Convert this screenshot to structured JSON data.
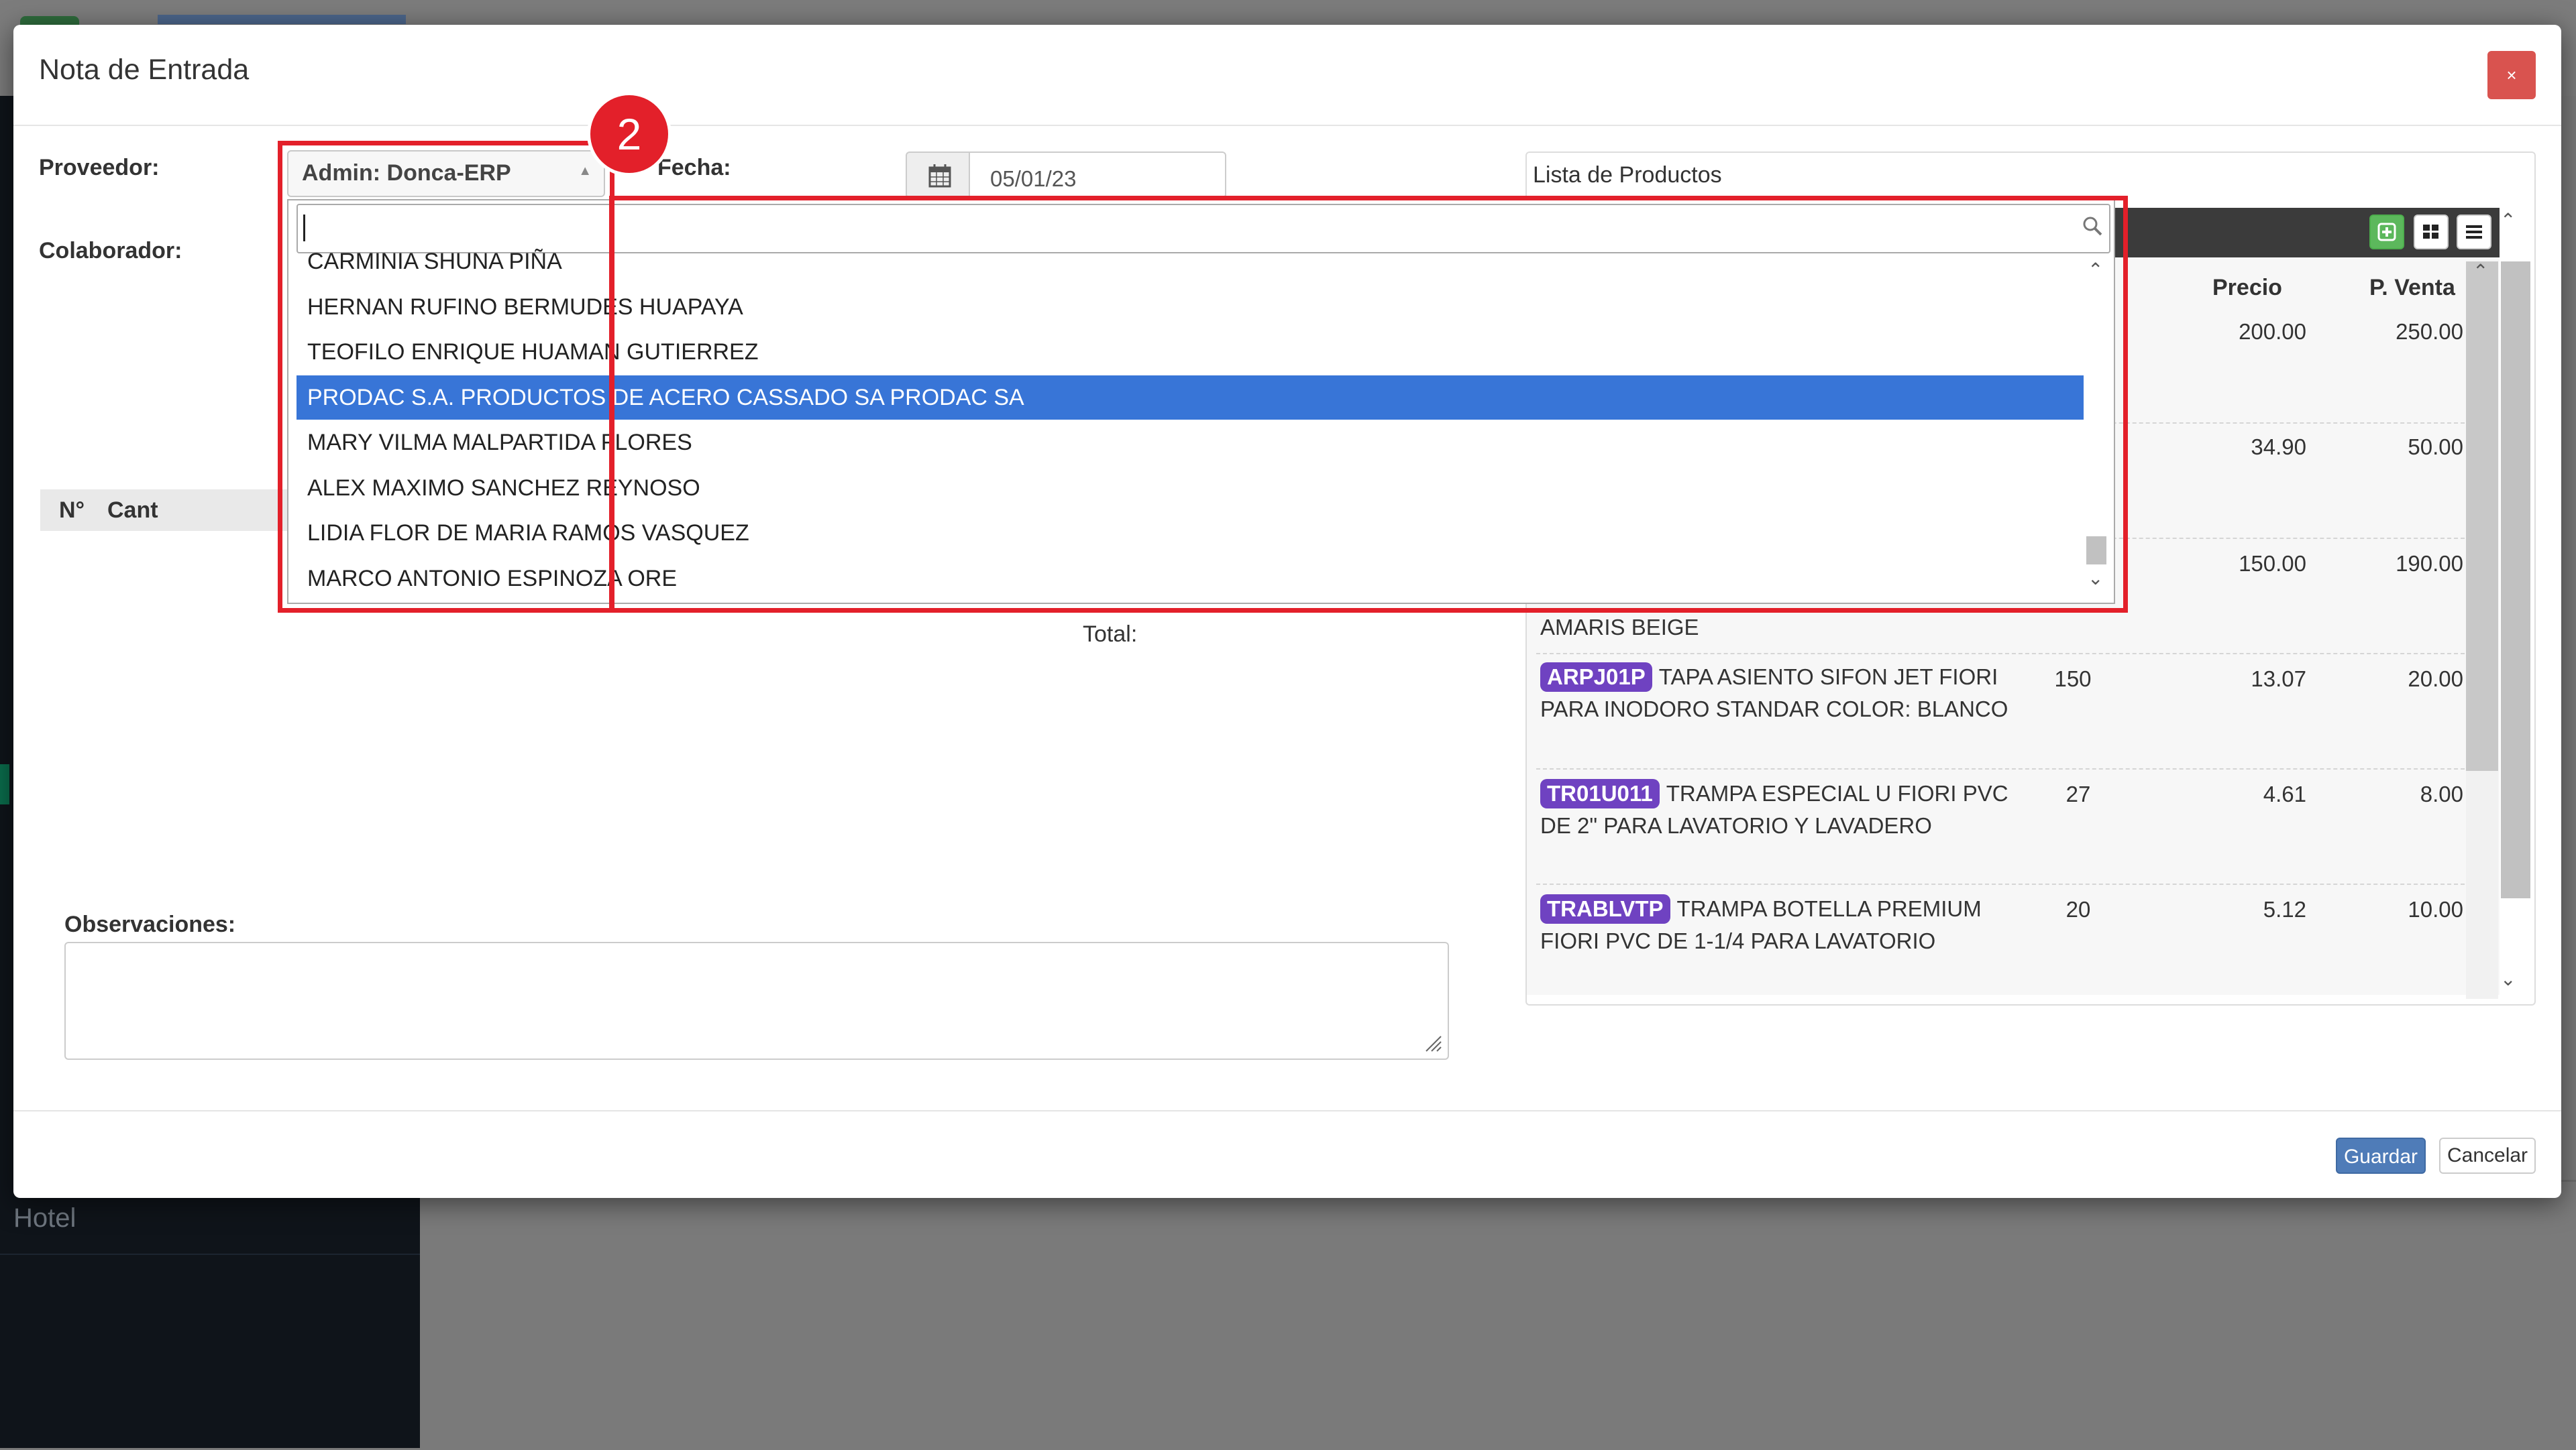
{
  "background": {
    "sidebar_item": "Hotel"
  },
  "modal": {
    "title": "Nota de Entrada",
    "close": "×",
    "labels": {
      "proveedor": "Proveedor:",
      "fecha": "Fecha:",
      "colaborador": "Colaborador:",
      "observaciones": "Observaciones:"
    },
    "proveedor_value": "Admin: Donca-ERP",
    "fecha_value": "05/01/23",
    "detail_headers": {
      "n": "N°",
      "cant": "Cant"
    },
    "total_label": "Total:",
    "buttons": {
      "guardar": "Guardar",
      "cancelar": "Cancelar"
    }
  },
  "annotation": {
    "step": "2"
  },
  "dropdown": {
    "search_value": "",
    "options": [
      "CARMINIA SHUNA PIÑA",
      "HERNAN RUFINO BERMUDES HUAPAYA",
      "TEOFILO ENRIQUE HUAMAN GUTIERREZ",
      "PRODAC S.A. PRODUCTOS DE ACERO CASSADO SA PRODAC SA",
      "MARY VILMA MALPARTIDA FLORES",
      "ALEX MAXIMO SANCHEZ REYNOSO",
      "LIDIA FLOR DE MARIA RAMOS VASQUEZ",
      "MARCO ANTONIO ESPINOZA ORE"
    ],
    "selected": "PRODAC S.A. PRODUCTOS DE ACERO CASSADO SA PRODAC SA"
  },
  "products": {
    "title": "Lista de Productos",
    "headers": {
      "precio": "Precio",
      "pventa": "P. Venta"
    },
    "rows": [
      {
        "code": "",
        "desc": "",
        "stock": "",
        "precio": "200.00",
        "pventa": "250.00"
      },
      {
        "code": "",
        "desc": "",
        "stock": "",
        "precio": "34.90",
        "pventa": "50.00"
      },
      {
        "code": "",
        "desc": "AMARIS BEIGE",
        "stock": "",
        "precio": "150.00",
        "pventa": "190.00"
      },
      {
        "code": "ARPJ01P",
        "desc": "TAPA ASIENTO SIFON JET FIORI PARA INODORO STANDAR COLOR: BLANCO",
        "stock": "150",
        "precio": "13.07",
        "pventa": "20.00"
      },
      {
        "code": "TR01U011",
        "desc": "TRAMPA ESPECIAL U FIORI PVC DE 2\" PARA LAVATORIO Y LAVADERO",
        "stock": "27",
        "precio": "4.61",
        "pventa": "8.00"
      },
      {
        "code": "TRABLVTP",
        "desc": "TRAMPA BOTELLA PREMIUM FIORI PVC DE 1-1/4 PARA LAVATORIO",
        "stock": "20",
        "precio": "5.12",
        "pventa": "10.00"
      }
    ]
  }
}
